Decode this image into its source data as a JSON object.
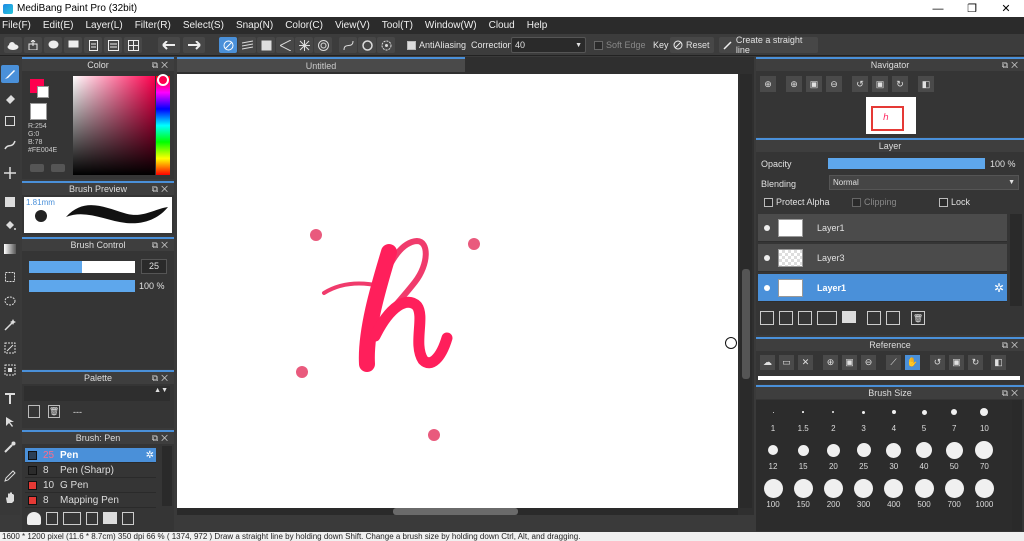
{
  "window": {
    "title": "MediBang Paint Pro (32bit)",
    "minimize": "—",
    "maximize": "❐",
    "close": "✕"
  },
  "menu": [
    "File(F)",
    "Edit(E)",
    "Layer(L)",
    "Filter(R)",
    "Select(S)",
    "Snap(N)",
    "Color(C)",
    "View(V)",
    "Tool(T)",
    "Window(W)",
    "Cloud",
    "Help"
  ],
  "toolbar": {
    "antialiasing": "AntiAliasing",
    "correction_label": "Correction",
    "correction_value": "40",
    "soft_edge": "Soft Edge",
    "key": "Key",
    "reset": "Reset",
    "straight_line": "Create a straight line"
  },
  "color_panel": {
    "title": "Color",
    "r": "R:254",
    "g": "G:0",
    "b": "B:78",
    "hex": "#FE004E",
    "fg_color": "#FE004E",
    "bg_color": "#FFFFFF"
  },
  "brush_preview": {
    "title": "Brush Preview",
    "size": "1.81mm"
  },
  "brush_control": {
    "title": "Brush Control",
    "size_value": "25",
    "opacity_value": "100 %",
    "size_fill": 0.5,
    "opacity_fill": 1.0
  },
  "palette": {
    "title": "Palette",
    "separator": "---"
  },
  "brush_list": {
    "title": "Brush: Pen",
    "items": [
      {
        "size": "25",
        "name": "Pen",
        "color": "#2a3e55",
        "selected": true
      },
      {
        "size": "8",
        "name": "Pen (Sharp)",
        "color": "#2b2b2b",
        "selected": false
      },
      {
        "size": "10",
        "name": "G Pen",
        "color": "#e53935",
        "selected": false
      },
      {
        "size": "8",
        "name": "Mapping Pen",
        "color": "#e53935",
        "selected": false
      }
    ]
  },
  "document": {
    "tab": "Untitled"
  },
  "navigator": {
    "title": "Navigator"
  },
  "layer_panel": {
    "title": "Layer",
    "opacity_label": "Opacity",
    "opacity_value": "100 %",
    "opacity_fill": 1.0,
    "blending_label": "Blending",
    "blending_value": "Normal",
    "protect_alpha": "Protect Alpha",
    "clipping": "Clipping",
    "lock": "Lock",
    "layers": [
      {
        "name": "Layer1",
        "selected": false
      },
      {
        "name": "Layer3",
        "selected": false
      },
      {
        "name": "Layer1",
        "selected": true
      }
    ]
  },
  "reference": {
    "title": "Reference"
  },
  "brush_size": {
    "title": "Brush Size",
    "sizes": [
      "1",
      "1.5",
      "2",
      "3",
      "4",
      "5",
      "7",
      "10",
      "12",
      "15",
      "20",
      "25",
      "30",
      "40",
      "50",
      "70",
      "100",
      "150",
      "200",
      "300",
      "400",
      "500",
      "700",
      "1000"
    ]
  },
  "status": "1600 * 1200 pixel   (11.6 * 8.7cm)   350 dpi   66 %   ( 1374, 972 )   Draw a straight line by holding down Shift. Change a brush size by holding down Ctrl, Alt, and dragging."
}
